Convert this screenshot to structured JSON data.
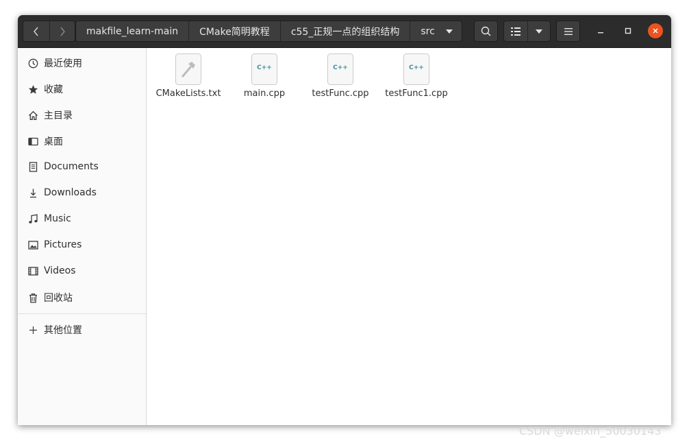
{
  "breadcrumbs": [
    "makfile_learn-main",
    "CMake简明教程",
    "c55_正规一点的组织结构",
    "src"
  ],
  "sidebar": {
    "items": [
      {
        "label": "最近使用",
        "icon": "clock-icon"
      },
      {
        "label": "收藏",
        "icon": "star-icon"
      },
      {
        "label": "主目录",
        "icon": "home-icon"
      },
      {
        "label": "桌面",
        "icon": "desktop-icon"
      },
      {
        "label": "Documents",
        "icon": "document-icon"
      },
      {
        "label": "Downloads",
        "icon": "download-icon"
      },
      {
        "label": "Music",
        "icon": "music-icon"
      },
      {
        "label": "Pictures",
        "icon": "picture-icon"
      },
      {
        "label": "Videos",
        "icon": "video-icon"
      },
      {
        "label": "回收站",
        "icon": "trash-icon"
      }
    ],
    "other_locations": {
      "label": "其他位置",
      "icon": "plus-icon"
    }
  },
  "files": [
    {
      "name": "CMakeLists.txt",
      "icon": "text-file-icon"
    },
    {
      "name": "main.cpp",
      "icon": "cpp-file-icon",
      "icon_text": "C++"
    },
    {
      "name": "testFunc.cpp",
      "icon": "cpp-file-icon",
      "icon_text": "C++"
    },
    {
      "name": "testFunc1.cpp",
      "icon": "cpp-file-icon",
      "icon_text": "C++"
    }
  ],
  "watermark": "CSDN @weixin_50030143",
  "colors": {
    "headerbar": "#2c2c2c",
    "close_button": "#e95420",
    "cpp_icon_text": "#3d8e9a"
  }
}
